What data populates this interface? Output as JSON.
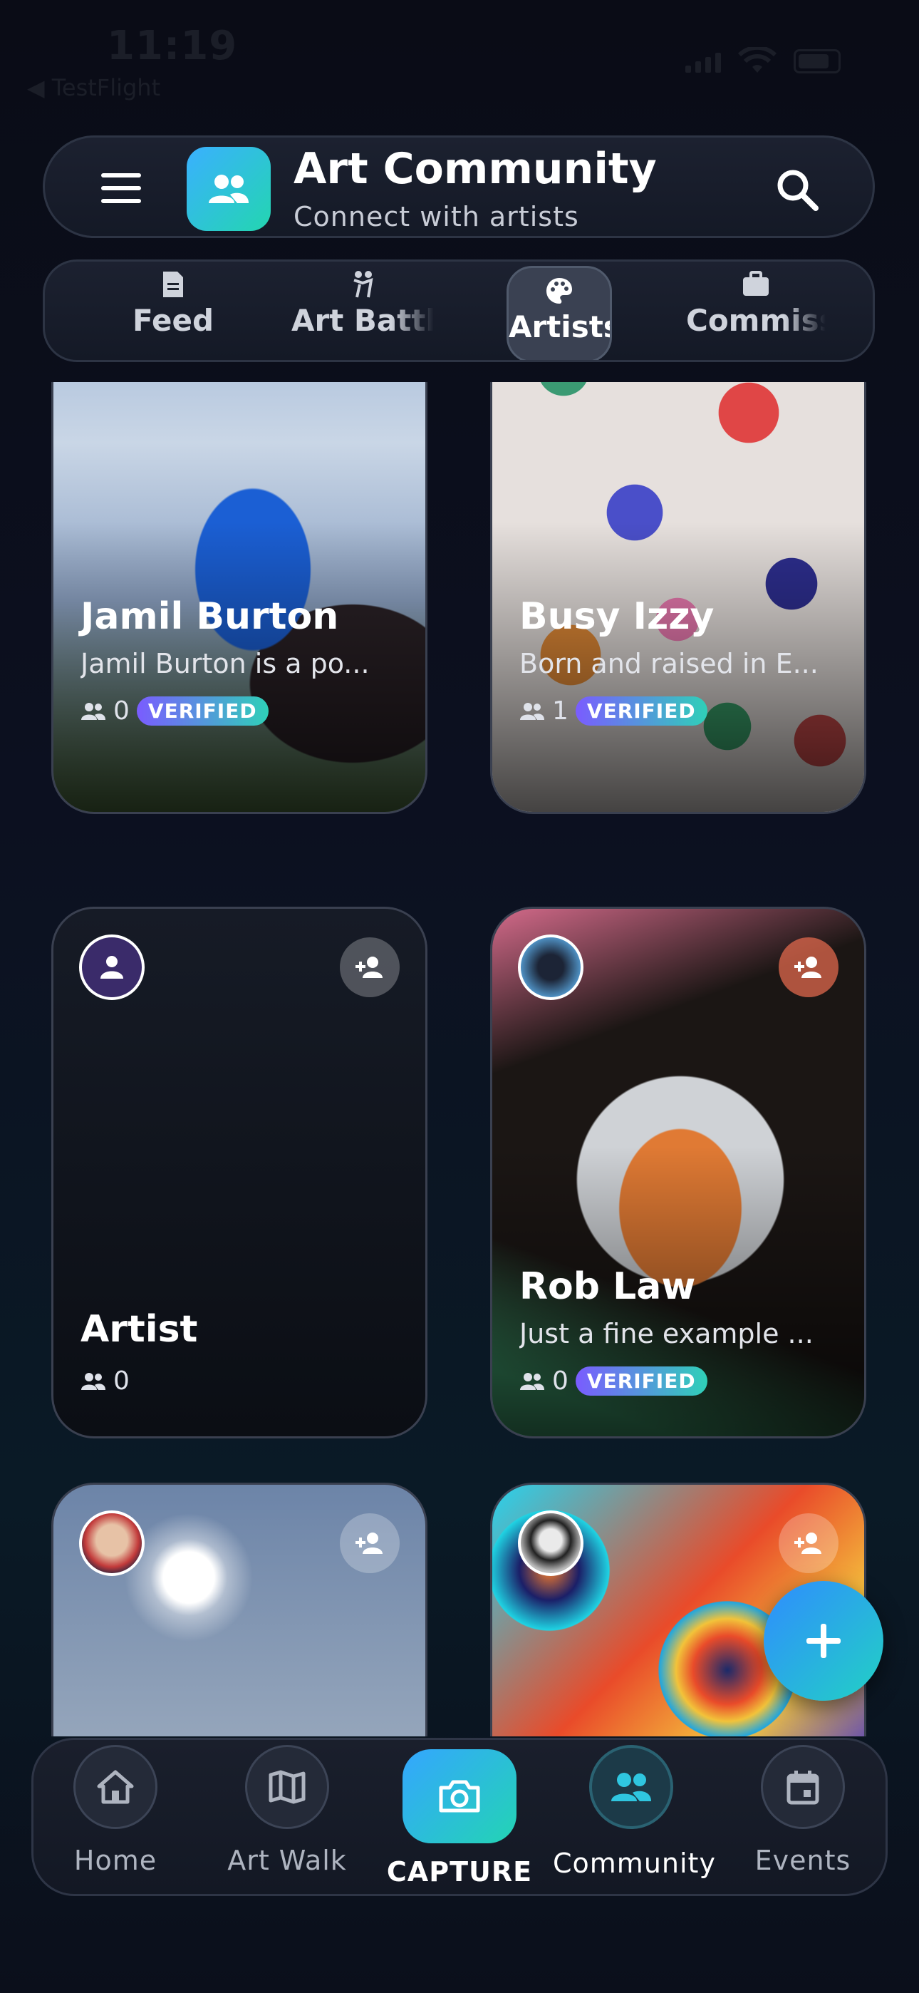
{
  "status_bar": {
    "time": "11:19",
    "back_label": "◀ TestFlight"
  },
  "header": {
    "title": "Art Community",
    "subtitle": "Connect with artists",
    "menu_icon": "menu-icon",
    "search_icon": "search-icon"
  },
  "tabs": [
    {
      "label": "Feed",
      "icon": "document-icon",
      "active": false
    },
    {
      "label": "Art Battle",
      "icon": "battle-icon",
      "active": false
    },
    {
      "label": "Artists",
      "icon": "palette-icon",
      "active": true
    },
    {
      "label": "Commissions",
      "icon": "briefcase-icon",
      "active": false
    }
  ],
  "artists": [
    {
      "name": "Jamil Burton",
      "bio": "Jamil Burton is a po...",
      "followers": "0",
      "verified": "VERIFIED"
    },
    {
      "name": "Busy Izzy",
      "bio": "Born and raised in E...",
      "followers": "1",
      "verified": "VERIFIED"
    },
    {
      "name": "Artist",
      "bio": "",
      "followers": "0",
      "verified": ""
    },
    {
      "name": "Rob Law",
      "bio": "Just a fine example ...",
      "followers": "0",
      "verified": "VERIFIED"
    }
  ],
  "fab": {
    "icon": "plus-icon"
  },
  "bottom_nav": [
    {
      "label": "Home",
      "icon": "home-icon"
    },
    {
      "label": "Art Walk",
      "icon": "map-icon"
    },
    {
      "label": "CAPTURE",
      "icon": "camera-icon"
    },
    {
      "label": "Community",
      "icon": "people-icon"
    },
    {
      "label": "Events",
      "icon": "calendar-icon"
    }
  ],
  "colors": {
    "accent_gradient_start": "#34a6ff",
    "accent_gradient_end": "#23d4b4",
    "badge_start": "#7a5cff",
    "badge_end": "#2fd0b8"
  }
}
